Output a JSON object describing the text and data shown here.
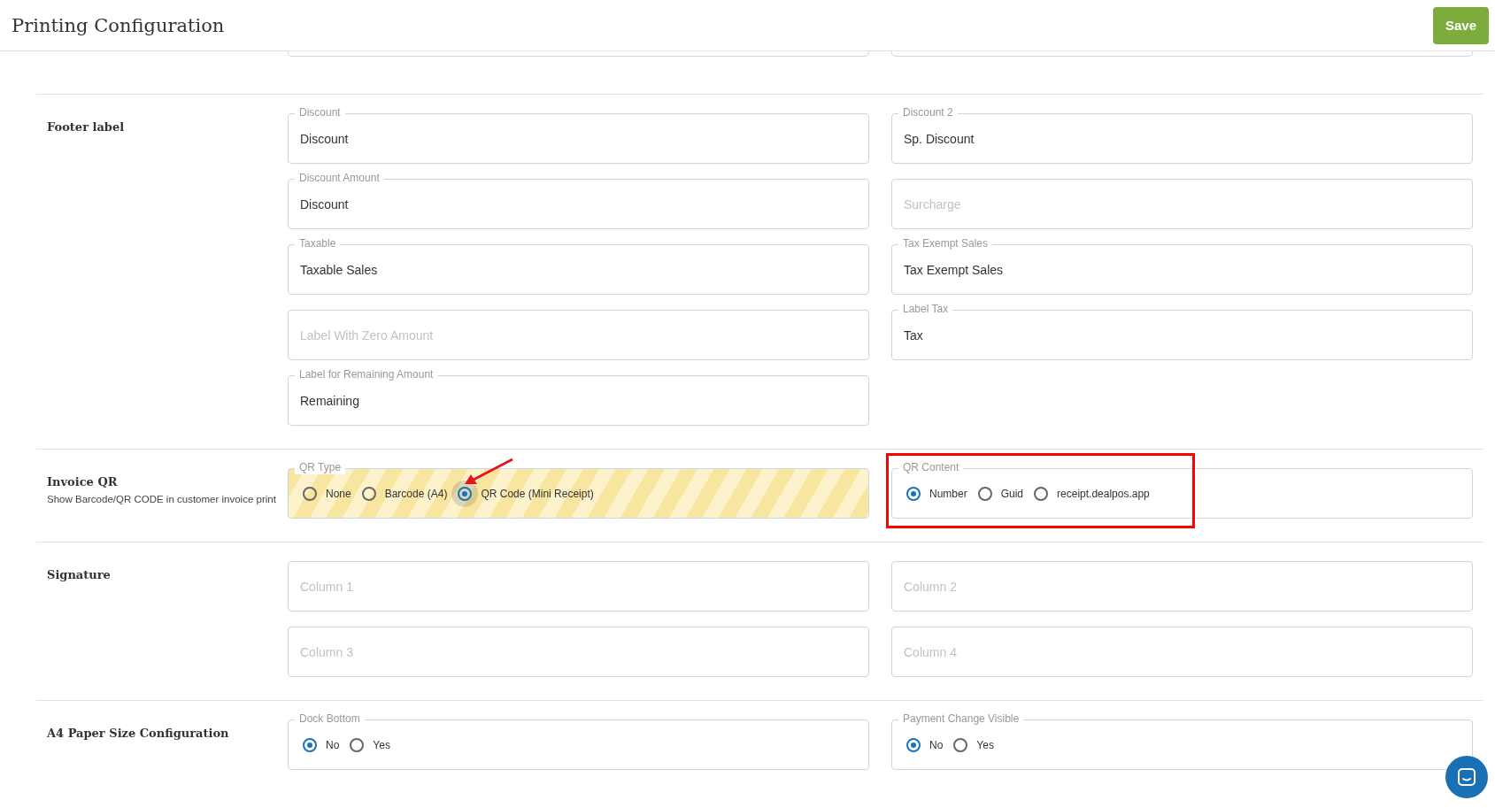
{
  "header": {
    "title": "Printing Configuration",
    "save_label": "Save"
  },
  "sections": [
    {
      "title": "Footer label",
      "rows": [
        [
          {
            "kind": "text",
            "label": "Discount",
            "value": "Discount"
          },
          {
            "kind": "text",
            "label": "Discount 2",
            "value": "Sp. Discount"
          }
        ],
        [
          {
            "kind": "text",
            "label": "Discount Amount",
            "value": "Discount"
          },
          {
            "kind": "text",
            "placeholder": "Surcharge"
          }
        ],
        [
          {
            "kind": "text",
            "label": "Taxable",
            "value": "Taxable Sales"
          },
          {
            "kind": "text",
            "label": "Tax Exempt Sales",
            "value": "Tax Exempt Sales"
          }
        ],
        [
          {
            "kind": "text",
            "placeholder": "Label With Zero Amount"
          },
          {
            "kind": "text",
            "label": "Label Tax",
            "value": "Tax"
          }
        ],
        [
          {
            "kind": "text",
            "label": "Label for Remaining Amount",
            "value": "Remaining"
          }
        ]
      ]
    },
    {
      "title": "Invoice QR",
      "subtitle": "Show Barcode/QR CODE in customer invoice print",
      "rows": [
        [
          {
            "kind": "radio",
            "label": "QR Type",
            "highlighted": true,
            "options": [
              {
                "label": "None",
                "selected": false
              },
              {
                "label": "Barcode (A4)",
                "selected": false
              },
              {
                "label": "QR Code (Mini Receipt)",
                "selected": true,
                "focused": true,
                "arrow": true
              }
            ]
          },
          {
            "kind": "radio",
            "label": "QR Content",
            "annotated": true,
            "options": [
              {
                "label": "Number",
                "selected": true
              },
              {
                "label": "Guid",
                "selected": false
              },
              {
                "label": "receipt.dealpos.app",
                "selected": false
              }
            ]
          }
        ]
      ]
    },
    {
      "title": "Signature",
      "rows": [
        [
          {
            "kind": "text",
            "placeholder": "Column 1"
          },
          {
            "kind": "text",
            "placeholder": "Column 2"
          }
        ],
        [
          {
            "kind": "text",
            "placeholder": "Column 3"
          },
          {
            "kind": "text",
            "placeholder": "Column 4"
          }
        ]
      ]
    },
    {
      "title": "A4 Paper Size Configuration",
      "rows": [
        [
          {
            "kind": "radio",
            "label": "Dock Bottom",
            "options": [
              {
                "label": "No",
                "selected": true
              },
              {
                "label": "Yes",
                "selected": false
              }
            ]
          },
          {
            "kind": "radio",
            "label": "Payment Change Visible",
            "options": [
              {
                "label": "No",
                "selected": true
              },
              {
                "label": "Yes",
                "selected": false
              }
            ]
          }
        ]
      ]
    }
  ]
}
